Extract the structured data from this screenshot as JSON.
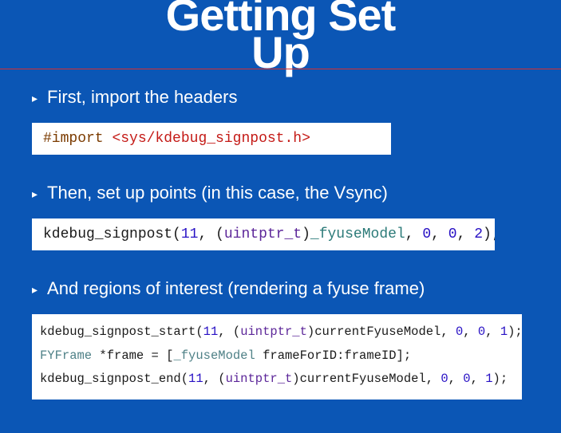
{
  "title_line1": "Getting Set",
  "title_line2": "Up",
  "bullets": {
    "b1": "First, import the headers",
    "b2": "Then, set up points (in this case, the Vsync)",
    "b3": "And regions of interest (rendering a fyuse frame)"
  },
  "code1": {
    "preproc": "#import",
    "include": "<sys/kdebug_signpost.h>"
  },
  "code2": {
    "func": "kdebug_signpost",
    "open": "(",
    "n11": "11",
    "comma": ", ",
    "cast_open": "(",
    "cast_type": "uintptr_t",
    "cast_close": ")",
    "ident": "_fyuseModel",
    "z1": "0",
    "z2": "0",
    "two": "2",
    "close": ");"
  },
  "code3": {
    "l1": {
      "func": "kdebug_signpost_start",
      "open": "(",
      "n11": "11",
      "comma": ", ",
      "cast_open": "(",
      "cast_type": "uintptr_t",
      "cast_close": ")",
      "ident": "currentFyuseModel",
      "z1": "0",
      "z2": "0",
      "one": "1",
      "close": ");"
    },
    "l2": {
      "cls": "FYFrame",
      "star_name": " *frame = [",
      "receiver": "_fyuseModel",
      "sp": " ",
      "msg": "frameForID:",
      "arg": "frameID",
      "close": "];"
    },
    "l3": {
      "func": "kdebug_signpost_end",
      "open": "(",
      "n11": "11",
      "comma": ", ",
      "cast_open": "(",
      "cast_type": "uintptr_t",
      "cast_close": ")",
      "ident": "currentFyuseModel",
      "z1": "0",
      "z2": "0",
      "one": "1",
      "close": ");"
    }
  }
}
